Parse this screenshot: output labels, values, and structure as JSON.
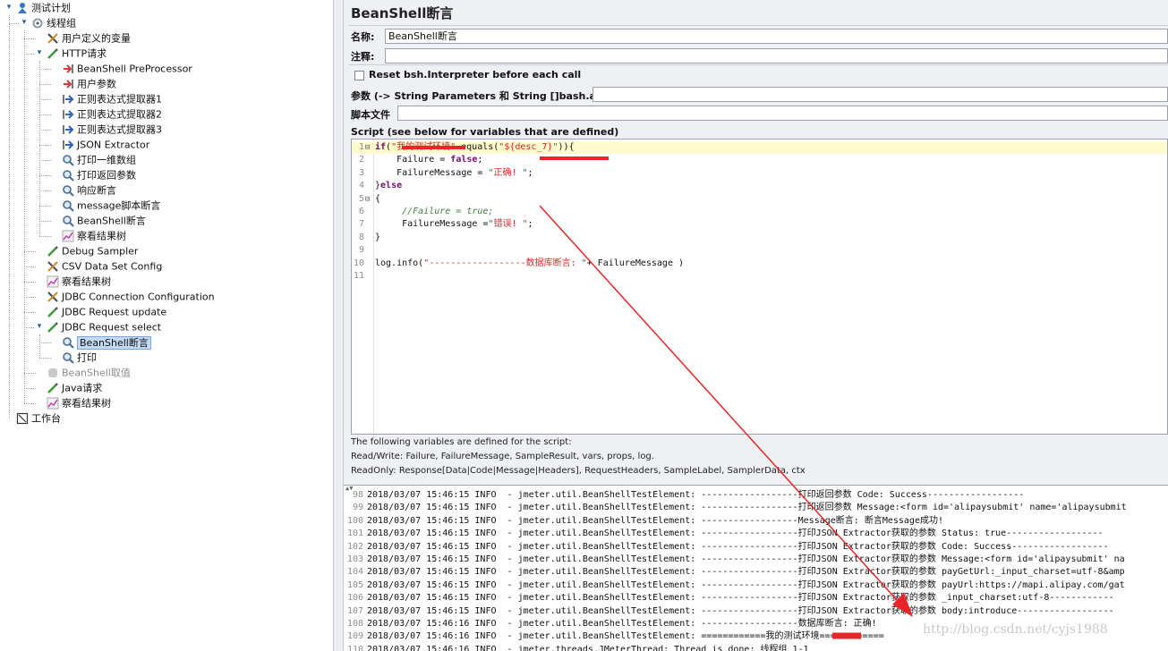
{
  "tree": {
    "items": [
      {
        "label": "测试计划",
        "icon": "test-plan-icon",
        "depth": 0,
        "toggle": "expanded"
      },
      {
        "label": "线程组",
        "icon": "gear-icon",
        "depth": 1,
        "toggle": "expanded"
      },
      {
        "label": "用户定义的变量",
        "icon": "config-tools-icon",
        "depth": 2
      },
      {
        "label": "HTTP请求",
        "icon": "pipette-icon",
        "depth": 2,
        "toggle": "expanded"
      },
      {
        "label": "BeanShell PreProcessor",
        "icon": "preprocessor-icon",
        "depth": 3
      },
      {
        "label": "用户参数",
        "icon": "preprocessor-icon",
        "depth": 3
      },
      {
        "label": "正则表达式提取器1",
        "icon": "postprocessor-icon",
        "depth": 3
      },
      {
        "label": "正则表达式提取器2",
        "icon": "postprocessor-icon",
        "depth": 3
      },
      {
        "label": "正则表达式提取器3",
        "icon": "postprocessor-icon",
        "depth": 3
      },
      {
        "label": "JSON Extractor",
        "icon": "postprocessor-icon",
        "depth": 3
      },
      {
        "label": "打印一维数组",
        "icon": "magnifier-icon",
        "depth": 3
      },
      {
        "label": "打印返回参数",
        "icon": "magnifier-icon",
        "depth": 3
      },
      {
        "label": "响应断言",
        "icon": "magnifier-icon",
        "depth": 3
      },
      {
        "label": "message脚本断言",
        "icon": "magnifier-icon",
        "depth": 3
      },
      {
        "label": "BeanShell断言",
        "icon": "magnifier-icon",
        "depth": 3
      },
      {
        "label": "察看结果树",
        "icon": "chart-icon",
        "depth": 3
      },
      {
        "label": "Debug Sampler",
        "icon": "pipette-icon",
        "depth": 2
      },
      {
        "label": "CSV Data Set Config",
        "icon": "config-tools-icon",
        "depth": 2
      },
      {
        "label": "察看结果树",
        "icon": "chart-icon",
        "depth": 2
      },
      {
        "label": "JDBC Connection Configuration",
        "icon": "config-tools-icon",
        "depth": 2
      },
      {
        "label": "JDBC Request update",
        "icon": "pipette-icon",
        "depth": 2
      },
      {
        "label": "JDBC Request select",
        "icon": "pipette-icon",
        "depth": 2,
        "toggle": "expanded"
      },
      {
        "label": "BeanShell断言",
        "icon": "magnifier-icon",
        "depth": 3,
        "selected": true
      },
      {
        "label": "打印",
        "icon": "magnifier-icon",
        "depth": 3
      },
      {
        "label": "BeanShell取值",
        "icon": "disabled-sampler-icon",
        "depth": 2,
        "disabled": true
      },
      {
        "label": "Java请求",
        "icon": "pipette-icon",
        "depth": 2
      },
      {
        "label": "察看结果树",
        "icon": "chart-icon",
        "depth": 2
      },
      {
        "label": "工作台",
        "icon": "workbench-icon",
        "depth": 0
      }
    ]
  },
  "panel": {
    "title": "BeanShell断言",
    "name_label": "名称:",
    "name_value": "BeanShell断言",
    "comment_label": "注释:",
    "comment_value": "",
    "reset_checkbox_label": "Reset bsh.Interpreter before each call",
    "reset_checked": false,
    "params_label": "参数 (-> String Parameters 和 String []bash.args)",
    "params_value": "",
    "script_file_label": "脚本文件",
    "script_file_value": "",
    "script_label": "Script (see below for variables that are defined)",
    "vars_heading": "The following variables are defined for the script:",
    "vars_readwrite": "Read/Write: Failure, FailureMessage, SampleResult, vars, props, log.",
    "vars_readonly": "ReadOnly: Response[Data|Code|Message|Headers], RequestHeaders, SampleLabel, SamplerData, ctx"
  },
  "script_lines": [
    {
      "no": "1",
      "fold": "⊟",
      "highlight": true,
      "tokens": [
        {
          "t": "if",
          "c": "kw"
        },
        {
          "t": "(",
          "c": ""
        },
        {
          "t": "\"我的测试环境\"",
          "c": "st"
        },
        {
          "t": ".equals(",
          "c": ""
        },
        {
          "t": "\"${desc_7}\"",
          "c": "st"
        },
        {
          "t": ")){",
          "c": ""
        }
      ]
    },
    {
      "no": "2",
      "fold": "",
      "tokens": [
        {
          "t": "    Failure = ",
          "c": ""
        },
        {
          "t": "false",
          "c": "kw"
        },
        {
          "t": ";",
          "c": ""
        }
      ]
    },
    {
      "no": "3",
      "fold": "",
      "tokens": [
        {
          "t": "    FailureMessage = ",
          "c": ""
        },
        {
          "t": "\"正确! \"",
          "c": "st"
        },
        {
          "t": ";",
          "c": ""
        }
      ]
    },
    {
      "no": "4",
      "fold": "",
      "tokens": [
        {
          "t": "}",
          "c": ""
        },
        {
          "t": "else",
          "c": "kw"
        }
      ]
    },
    {
      "no": "5",
      "fold": "⊟",
      "tokens": [
        {
          "t": "{",
          "c": ""
        }
      ]
    },
    {
      "no": "6",
      "fold": "",
      "tokens": [
        {
          "t": "     //Failure = true;",
          "c": "cm"
        }
      ]
    },
    {
      "no": "7",
      "fold": "",
      "tokens": [
        {
          "t": "     FailureMessage =",
          "c": ""
        },
        {
          "t": "\"错误! \"",
          "c": "st"
        },
        {
          "t": ";",
          "c": ""
        }
      ]
    },
    {
      "no": "8",
      "fold": "",
      "tokens": [
        {
          "t": "}",
          "c": ""
        }
      ]
    },
    {
      "no": "9",
      "fold": "",
      "tokens": []
    },
    {
      "no": "10",
      "fold": "",
      "tokens": [
        {
          "t": "log.info(",
          "c": ""
        },
        {
          "t": "\"------------------数据库断言: \"",
          "c": "st"
        },
        {
          "t": "+ FailureMessage )",
          "c": ""
        }
      ]
    },
    {
      "no": "11",
      "fold": "",
      "tokens": []
    }
  ],
  "log_lines": [
    {
      "no": "98",
      "text": "2018/03/07 15:46:15 INFO  - jmeter.util.BeanShellTestElement: ------------------打印返回参数 Code: Success------------------"
    },
    {
      "no": "99",
      "text": "2018/03/07 15:46:15 INFO  - jmeter.util.BeanShellTestElement: ------------------打印返回参数 Message:<form id='alipaysubmit' name='alipaysubmit"
    },
    {
      "no": "100",
      "text": "2018/03/07 15:46:15 INFO  - jmeter.util.BeanShellTestElement: ------------------Message断言: 断言Message成功!"
    },
    {
      "no": "101",
      "text": "2018/03/07 15:46:15 INFO  - jmeter.util.BeanShellTestElement: ------------------打印JSON Extractor获取的参数 Status: true------------------"
    },
    {
      "no": "102",
      "text": "2018/03/07 15:46:15 INFO  - jmeter.util.BeanShellTestElement: ------------------打印JSON Extractor获取的参数 Code: Success------------------"
    },
    {
      "no": "103",
      "text": "2018/03/07 15:46:15 INFO  - jmeter.util.BeanShellTestElement: ------------------打印JSON Extractor获取的参数 Message:<form id='alipaysubmit' na"
    },
    {
      "no": "104",
      "text": "2018/03/07 15:46:15 INFO  - jmeter.util.BeanShellTestElement: ------------------打印JSON Extractor获取的参数 payGetUrl:_input_charset=utf-8&amp"
    },
    {
      "no": "105",
      "text": "2018/03/07 15:46:15 INFO  - jmeter.util.BeanShellTestElement: ------------------打印JSON Extractor获取的参数 payUrl:https://mapi.alipay.com/gat"
    },
    {
      "no": "106",
      "text": "2018/03/07 15:46:15 INFO  - jmeter.util.BeanShellTestElement: ------------------打印JSON Extractor获取的参数 _input_charset:utf-8------------"
    },
    {
      "no": "107",
      "text": "2018/03/07 15:46:15 INFO  - jmeter.util.BeanShellTestElement: ------------------打印JSON Extractor获取的参数 body:introduce------------------"
    },
    {
      "no": "108",
      "text": "2018/03/07 15:46:16 INFO  - jmeter.util.BeanShellTestElement: ------------------数据库断言: 正确!"
    },
    {
      "no": "109",
      "text": "2018/03/07 15:46:16 INFO  - jmeter.util.BeanShellTestElement: ============我的测试环境============"
    },
    {
      "no": "110",
      "text": "2018/03/07 15:46:16 INFO  - jmeter.threads.JMeterThread: Thread is done: 线程组 1-1"
    }
  ],
  "watermark": "http://blog.csdn.net/cyjs1988",
  "colors": {
    "annotation": "#e8262a",
    "selection": "#c3d9f4",
    "highlight_line": "#fffbcc"
  }
}
